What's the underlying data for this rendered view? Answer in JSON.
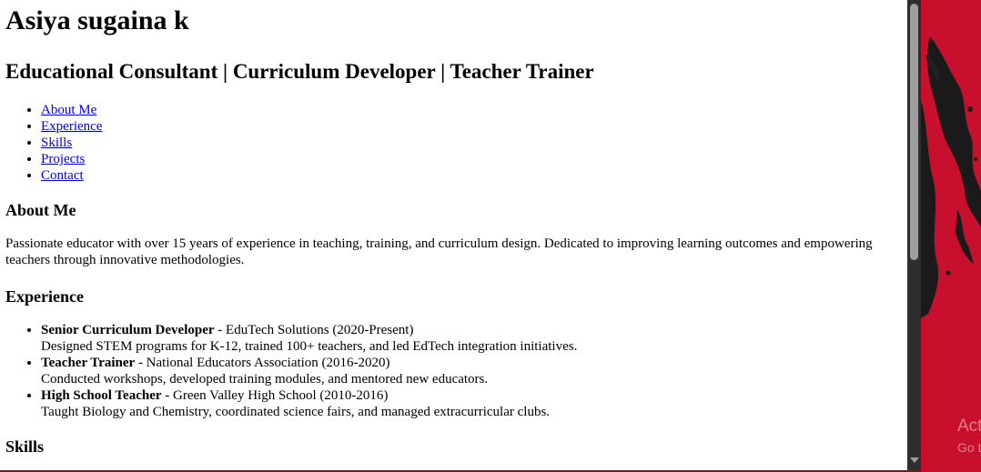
{
  "header": {
    "name": "Asiya sugaina k",
    "tagline": "Educational Consultant | Curriculum Developer | Teacher Trainer"
  },
  "nav": {
    "items": [
      "About Me",
      "Experience",
      "Skills",
      "Projects",
      "Contact"
    ]
  },
  "about": {
    "heading": "About Me",
    "text": "Passionate educator with over 15 years of experience in teaching, training, and curriculum design. Dedicated to improving learning outcomes and empowering teachers through innovative methodologies."
  },
  "experience": {
    "heading": "Experience",
    "items": [
      {
        "title": "Senior Curriculum Developer",
        "org": " - EduTech Solutions (2020-Present)",
        "desc": "Designed STEM programs for K-12, trained 100+ teachers, and led EdTech integration initiatives."
      },
      {
        "title": "Teacher Trainer",
        "org": " - National Educators Association (2016-2020)",
        "desc": "Conducted workshops, developed training modules, and mentored new educators."
      },
      {
        "title": "High School Teacher",
        "org": " - Green Valley High School (2010-2016)",
        "desc": "Taught Biology and Chemistry, coordinated science fairs, and managed extracurricular clubs."
      }
    ]
  },
  "skills": {
    "heading": "Skills"
  },
  "desktop": {
    "watermark_line1": "Act",
    "watermark_line2": "Go t",
    "background_color": "#c8102e"
  }
}
